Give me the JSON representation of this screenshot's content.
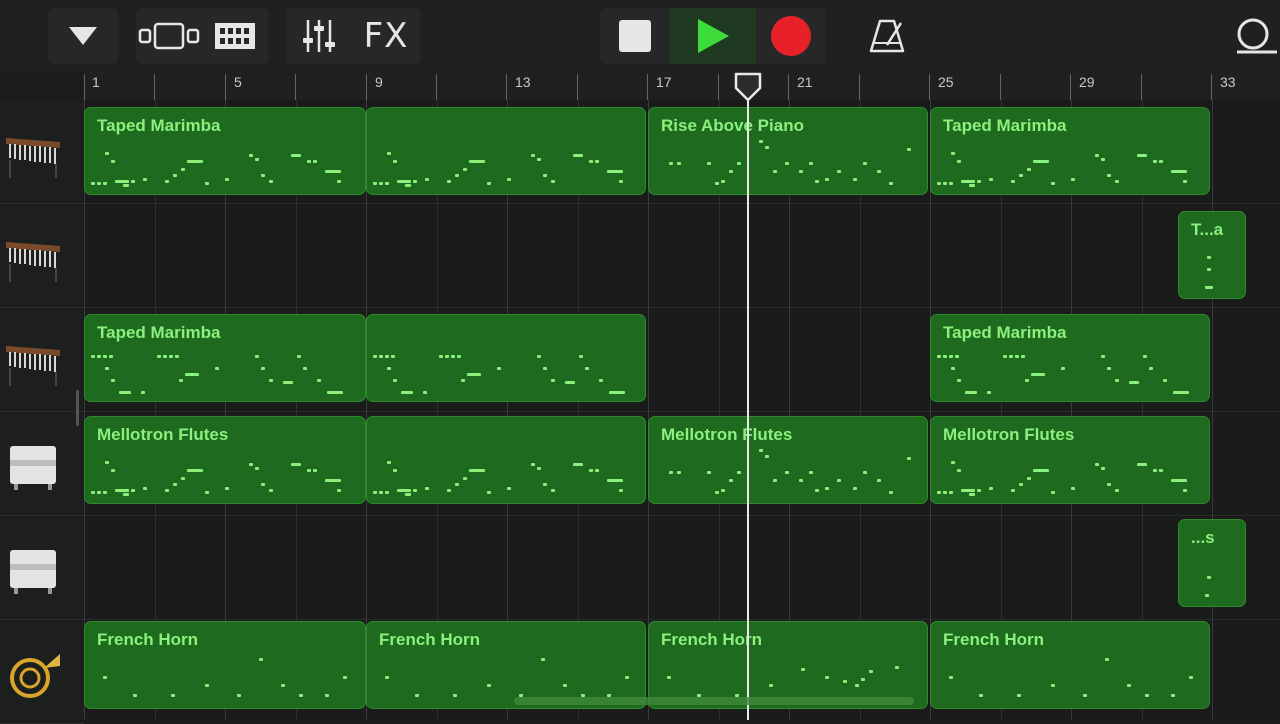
{
  "toolbar": {
    "fx_label": "FX"
  },
  "ruler": {
    "bar_numbers": [
      "1",
      "5",
      "9",
      "13",
      "17",
      "21",
      "25",
      "29",
      "33"
    ]
  },
  "tracks": [
    {
      "instrument": "marimba-icon"
    },
    {
      "instrument": "marimba-icon"
    },
    {
      "instrument": "marimba-icon"
    },
    {
      "instrument": "organ-icon"
    },
    {
      "instrument": "organ-icon"
    },
    {
      "instrument": "french-horn-icon"
    }
  ],
  "regions": [
    {
      "track": 0,
      "title": "Taped Marimba"
    },
    {
      "track": 0,
      "title": ""
    },
    {
      "track": 0,
      "title": "Rise Above Piano"
    },
    {
      "track": 0,
      "title": "Taped Marimba"
    },
    {
      "track": 1,
      "title": "T...a"
    },
    {
      "track": 2,
      "title": "Taped Marimba"
    },
    {
      "track": 2,
      "title": ""
    },
    {
      "track": 2,
      "title": "Taped Marimba"
    },
    {
      "track": 3,
      "title": "Mellotron Flutes"
    },
    {
      "track": 3,
      "title": ""
    },
    {
      "track": 3,
      "title": "Mellotron Flutes"
    },
    {
      "track": 3,
      "title": "Mellotron Flutes"
    },
    {
      "track": 4,
      "title": "...s"
    },
    {
      "track": 5,
      "title": "French Horn"
    },
    {
      "track": 5,
      "title": "French Horn"
    },
    {
      "track": 5,
      "title": "French Horn"
    },
    {
      "track": 5,
      "title": "French Horn"
    }
  ],
  "colors": {
    "region_fill": "#1e6b1f",
    "region_text": "#8cf07c",
    "play_green": "#3ddc3a",
    "record_red": "#e8202a"
  }
}
